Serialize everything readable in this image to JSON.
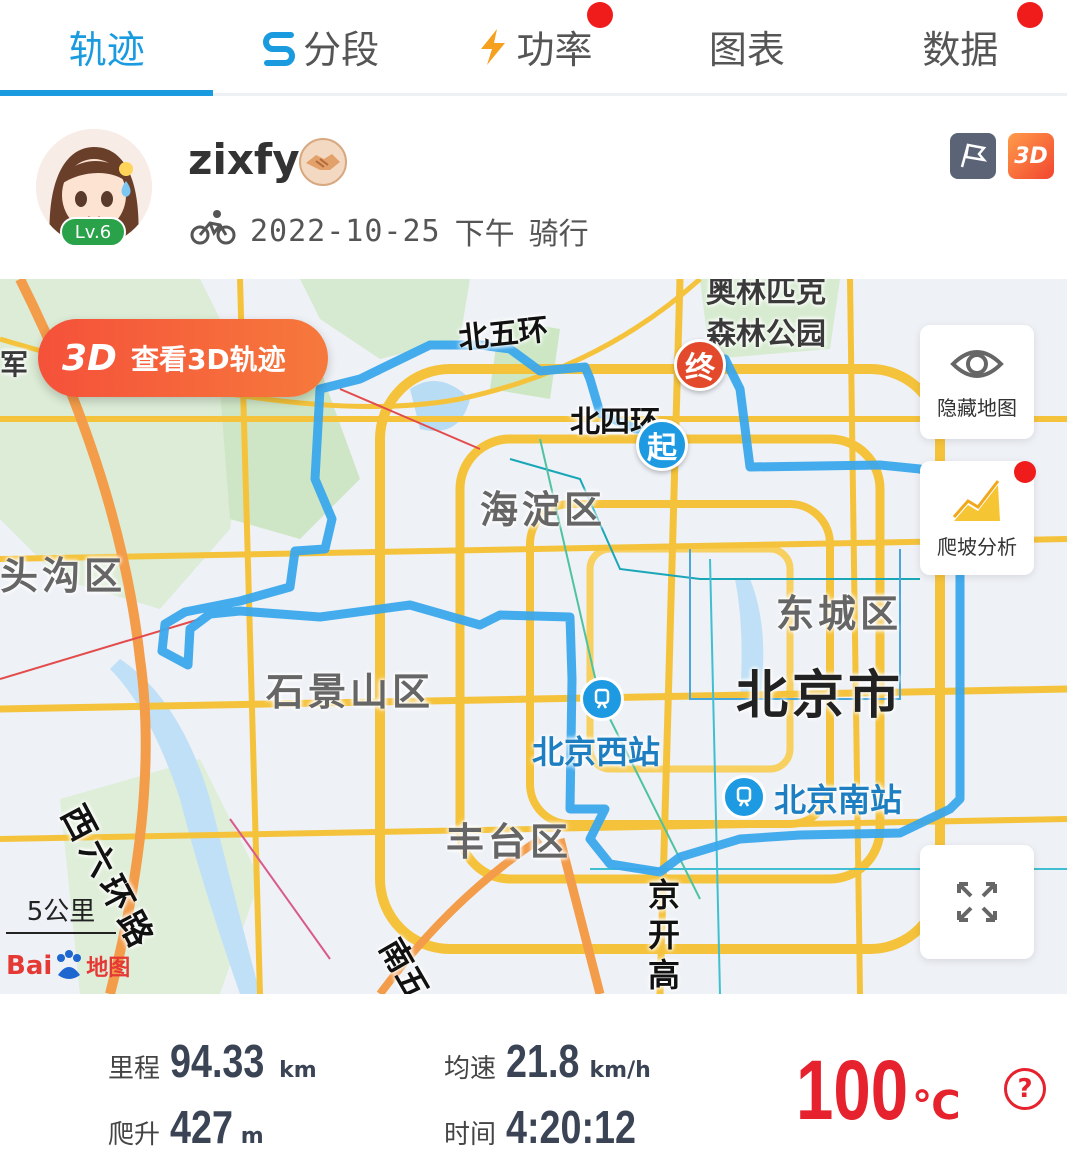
{
  "tabs": [
    {
      "label": "轨迹",
      "active": true,
      "badge": false
    },
    {
      "label": "分段",
      "active": false,
      "badge": true
    },
    {
      "label": "功率",
      "active": false,
      "badge": true
    },
    {
      "label": "图表",
      "active": false,
      "badge": false
    },
    {
      "label": "数据",
      "active": false,
      "badge": false
    }
  ],
  "profile": {
    "username": "zixfy",
    "level": "Lv.6",
    "date": "2022-10-25",
    "period": "下午",
    "activity": "骑行",
    "btn_3d": "3D"
  },
  "map": {
    "view3d_big": "3D",
    "view3d_text": "查看3D轨迹",
    "hide_map": "隐藏地图",
    "climb_analysis": "爬坡分析",
    "start_marker": "起",
    "end_marker": "终",
    "scale": "5公里",
    "provider_a": "Bai",
    "provider_b": "地图",
    "labels": {
      "ring5": "北五环",
      "ring4": "北四环",
      "forest1": "奥林匹克",
      "forest2": "森林公园",
      "haidian": "海淀区",
      "mentougou": "头沟区",
      "jun": "军",
      "shijingshan": "石景山区",
      "dongcheng": "东城区",
      "beijing": "北京市",
      "west_station": "北京西站",
      "south_station": "北京南站",
      "fengtai": "丰台区",
      "xiliuhuan": "西六环路",
      "jingkai": "京开高",
      "nanwu": "南五"
    }
  },
  "stats": {
    "distance": {
      "label": "里程",
      "value": "94.33",
      "unit": "km"
    },
    "avg_speed": {
      "label": "均速",
      "value": "21.8",
      "unit": "km/h"
    },
    "climb": {
      "label": "爬升",
      "value": "427",
      "unit": "m"
    },
    "time": {
      "label": "时间",
      "value": "4:20:12"
    },
    "temperature": {
      "value": "100",
      "unit": "℃"
    }
  },
  "colors": {
    "accent": "#1a9be0",
    "route": "#3aa8ec",
    "temp": "#e5222e",
    "badge_red": "#f01c1c"
  }
}
